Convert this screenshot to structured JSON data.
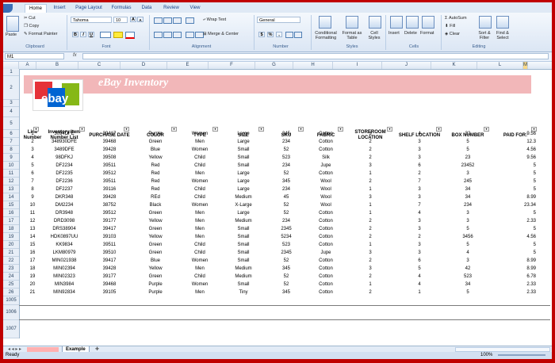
{
  "ribbon": {
    "tabs": [
      "Home",
      "Insert",
      "Page Layout",
      "Formulas",
      "Data",
      "Review",
      "View"
    ],
    "clipboard": {
      "paste": "Paste",
      "cut": "Cut",
      "copy": "Copy",
      "format_painter": "Format Painter",
      "label": "Clipboard"
    },
    "font": {
      "name": "Tahoma",
      "size": "10",
      "bold": "B",
      "italic": "I",
      "underline": "U",
      "grow": "A",
      "shrink": "A",
      "label": "Font"
    },
    "alignment": {
      "wrap": "Wrap Text",
      "merge": "Merge & Center",
      "label": "Alignment"
    },
    "number": {
      "format": "General",
      "currency": "$",
      "percent": "%",
      "comma": ",",
      "label": "Number"
    },
    "styles": {
      "conditional": "Conditional Formatting",
      "as_table": "Format as Table",
      "cell_styles": "Cell Styles",
      "label": "Styles"
    },
    "cells": {
      "insert": "Insert",
      "delete": "Delete",
      "format": "Format",
      "label": "Cells"
    },
    "editing": {
      "autosum": "AutoSum",
      "fill": "Fill",
      "clear": "Clear",
      "sort": "Sort & Filter",
      "find": "Find & Select",
      "label": "Editing"
    }
  },
  "formula_bar": {
    "name_box": "M1",
    "fx": "fx",
    "content": ""
  },
  "columns": [
    "A",
    "B",
    "C",
    "D",
    "E",
    "F",
    "G",
    "H",
    "I",
    "J",
    "K",
    "L",
    "M"
  ],
  "selected_column": "M",
  "row_numbers": [
    "1",
    "2",
    "3",
    "4",
    "5",
    "6",
    "7",
    "8",
    "9",
    "10",
    "11",
    "12",
    "13",
    "14",
    "15",
    "16",
    "17",
    "18",
    "19",
    "20",
    "21",
    "22",
    "23",
    "24",
    "25",
    "26",
    "1005",
    "1006",
    "1007"
  ],
  "banner": {
    "title": "eBay Inventory",
    "logo_text": "ebay"
  },
  "headers": [
    "Line Number",
    "Inventory Item Number List",
    "PURCHASE DATE",
    "COLOR",
    "TYPE",
    "SIZE",
    "SKU",
    "FABRIC",
    "STOREROOM LOCATION",
    "SHELF LOCATION",
    "BOX NUMBER",
    "PAID FOR:"
  ],
  "rows": [
    [
      "1",
      "3094DFE",
      "39417",
      "Purple",
      "Women",
      "Large",
      "345",
      "Cotton",
      "3",
      "4",
      "32",
      "9.56"
    ],
    [
      "2",
      "348930DFE",
      "39468",
      "Green",
      "Men",
      "Large",
      "234",
      "Cotton",
      "2",
      "3",
      "5",
      "12.3"
    ],
    [
      "3",
      "3489DFE",
      "39428",
      "Blue",
      "Women",
      "Small",
      "52",
      "Cotton",
      "2",
      "3",
      "5",
      "4.56"
    ],
    [
      "4",
      "98DFKJ",
      "39508",
      "Yellow",
      "Child",
      "Small",
      "523",
      "Silk",
      "2",
      "3",
      "23",
      "9.56"
    ],
    [
      "5",
      "DF2234",
      "39511",
      "Red",
      "Child",
      "Small",
      "234",
      "Jupe",
      "3",
      "6",
      "23452",
      "5"
    ],
    [
      "6",
      "DF2235",
      "39512",
      "Red",
      "Men",
      "Large",
      "52",
      "Cotton",
      "1",
      "2",
      "3",
      "5"
    ],
    [
      "7",
      "DF2236",
      "39511",
      "Red",
      "Women",
      "Large",
      "345",
      "Wool",
      "2",
      "7",
      "245",
      "5"
    ],
    [
      "8",
      "DF2237",
      "39116",
      "Red",
      "Child",
      "Large",
      "234",
      "Wool",
      "1",
      "3",
      "34",
      "5"
    ],
    [
      "9",
      "DKR348",
      "39428",
      "REd",
      "Child",
      "Medium",
      "45",
      "Wool",
      "3",
      "3",
      "34",
      "8.99"
    ],
    [
      "10",
      "DM2234",
      "38752",
      "Black",
      "Women",
      "X-Large",
      "52",
      "Wool",
      "1",
      "7",
      "234",
      "23.34"
    ],
    [
      "11",
      "DR3948",
      "39512",
      "Green",
      "Men",
      "Large",
      "52",
      "Cotton",
      "1",
      "4",
      "3",
      "5"
    ],
    [
      "12",
      "DRD3098",
      "39177",
      "Yellow",
      "Men",
      "Medium",
      "234",
      "Cotton",
      "2",
      "3",
      "3",
      "2.33"
    ],
    [
      "13",
      "DRS38904",
      "39417",
      "Green",
      "Men",
      "Small",
      "2345",
      "Cotton",
      "2",
      "3",
      "5",
      "5"
    ],
    [
      "14",
      "HDK0897UU",
      "39103",
      "Yellow",
      "Men",
      "Small",
      "5234",
      "Cotton",
      "2",
      "2",
      "3456",
      "4.56"
    ],
    [
      "15",
      "KK9834",
      "39511",
      "Green",
      "Child",
      "Small",
      "523",
      "Cotton",
      "1",
      "3",
      "5",
      "5"
    ],
    [
      "16",
      "LKM80979",
      "39510",
      "Green",
      "Child",
      "Small",
      "2345",
      "Jupe",
      "3",
      "3",
      "4",
      "5"
    ],
    [
      "17",
      "MIN021938",
      "39417",
      "Blue",
      "Women",
      "Small",
      "52",
      "Cotton",
      "2",
      "6",
      "3",
      "8.99"
    ],
    [
      "18",
      "MIN02394",
      "39428",
      "Yellow",
      "Men",
      "Medium",
      "345",
      "Cotton",
      "3",
      "5",
      "42",
      "8.99"
    ],
    [
      "19",
      "MIN02323",
      "39177",
      "Green",
      "Child",
      "Medium",
      "52",
      "Cotton",
      "2",
      "4",
      "523",
      "6.78"
    ],
    [
      "20",
      "MIN3984",
      "39468",
      "Purple",
      "Women",
      "Small",
      "52",
      "Cotton",
      "1",
      "4",
      "34",
      "2.33"
    ],
    [
      "21",
      "MIN92834",
      "39105",
      "Purple",
      "Men",
      "Tiny",
      "345",
      "Cotton",
      "2",
      "1",
      "5",
      "2.33"
    ]
  ],
  "sheet_tabs": [
    "Example"
  ],
  "status": {
    "ready": "Ready",
    "zoom": "100%"
  }
}
